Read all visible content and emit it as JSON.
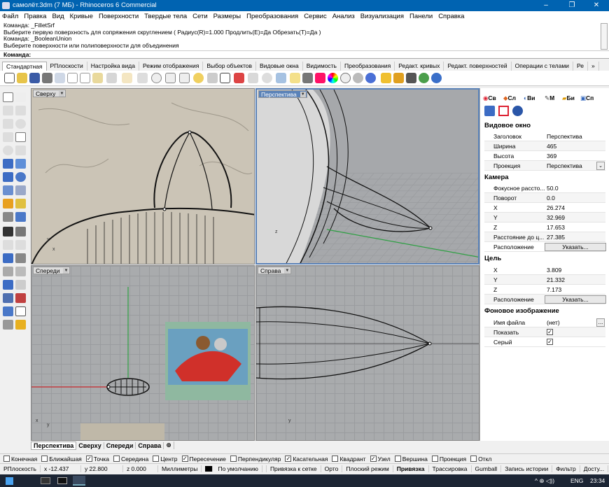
{
  "window": {
    "title": "самолёт.3dm (7 МБ) - Rhinoceros 6 Commercial",
    "minimize": "–",
    "maximize": "❐",
    "close": "✕"
  },
  "menu": [
    "Файл",
    "Правка",
    "Вид",
    "Кривые",
    "Поверхности",
    "Твердые тела",
    "Сети",
    "Размеры",
    "Преобразования",
    "Сервис",
    "Анализ",
    "Визуализация",
    "Панели",
    "Справка"
  ],
  "command_history": [
    "Команда: _FilletSrf",
    "Выберите первую поверхность для сопряжения скруглением ( Радиус(R)=1.000  Продлить(E)=Да  Обрезать(T)=Да )",
    "Команда: _BooleanUnion",
    "Выберите поверхности или полиповерхности для объединения"
  ],
  "command_prompt": "Команда:",
  "toolbar_tabs": [
    "Стандартная",
    "РПлоскости",
    "Настройка вида",
    "Режим отображения",
    "Выбор объектов",
    "Видовые окна",
    "Видимость",
    "Преобразования",
    "Редакт. кривых",
    "Редакт. поверхностей",
    "Операции с телами",
    "Ре"
  ],
  "toolbar_tabs_more": "»",
  "viewports": {
    "top": "Сверху",
    "perspective": "Перспектива",
    "front": "Спереди",
    "right": "Справа",
    "axis_x": "x",
    "axis_y": "y",
    "axis_z": "z"
  },
  "viewport_tabs": [
    "Перспектива",
    "Сверху",
    "Спереди",
    "Справа"
  ],
  "viewport_tab_add": "⊕",
  "panel": {
    "tabs": [
      "Св",
      "Сл",
      "Ви",
      "М",
      "Би",
      "Сп"
    ],
    "viewport_section": "Видовое окно",
    "title_label": "Заголовок",
    "title_value": "Перспектива",
    "width_label": "Ширина",
    "width_value": "465",
    "height_label": "Высота",
    "height_value": "369",
    "projection_label": "Проекция",
    "projection_value": "Перспектива",
    "camera_section": "Камера",
    "focal_label": "Фокусное рассто...",
    "focal_value": "50.0",
    "rotation_label": "Поворот",
    "rotation_value": "0.0",
    "cx_label": "X",
    "cx_value": "26.274",
    "cy_label": "Y",
    "cy_value": "32.969",
    "cz_label": "Z",
    "cz_value": "17.653",
    "dist_label": "Расстояние до ц...",
    "dist_value": "27.385",
    "loc_label": "Расположение",
    "loc_button": "Указать...",
    "target_section": "Цель",
    "tx_label": "X",
    "tx_value": "3.809",
    "ty_label": "Y",
    "ty_value": "21.332",
    "tz_label": "Z",
    "tz_value": "7.173",
    "tloc_label": "Расположение",
    "tloc_button": "Указать...",
    "bg_section": "Фоновое изображение",
    "file_label": "Имя файла",
    "file_value": "(нет)",
    "file_button": "...",
    "show_label": "Показать",
    "gray_label": "Серый"
  },
  "osnaps": [
    {
      "label": "Конечная",
      "checked": false
    },
    {
      "label": "Ближайшая",
      "checked": false
    },
    {
      "label": "Точка",
      "checked": true
    },
    {
      "label": "Середина",
      "checked": false
    },
    {
      "label": "Центр",
      "checked": false
    },
    {
      "label": "Пересечение",
      "checked": true
    },
    {
      "label": "Перпендикуляр",
      "checked": false
    },
    {
      "label": "Касательная",
      "checked": true
    },
    {
      "label": "Квадрант",
      "checked": false
    },
    {
      "label": "Узел",
      "checked": true
    },
    {
      "label": "Вершина",
      "checked": false
    },
    {
      "label": "Проекция",
      "checked": false
    },
    {
      "label": "Откл",
      "checked": false
    }
  ],
  "status": {
    "cplane": "РПлоскость",
    "x": "x -12.437",
    "y": "y 22.800",
    "z": "z 0.000",
    "units": "Миллиметры",
    "layer": "По умолчанию",
    "grid_snap": "Привязка к сетке",
    "ortho": "Орто",
    "planar": "Плоский режим",
    "osnap": "Привязка",
    "smarttrack": "Трассировка",
    "gumball": "Gumball",
    "history": "Запись истории",
    "filter": "Фильтр",
    "access": "Досту..."
  },
  "taskbar": {
    "lang": "ENG",
    "time": "23:34",
    "tray": "^ ⊕ ◁))"
  },
  "colors": {
    "titlebar": "#0063b1",
    "active_viewport": "#5a82b8",
    "x_axis": "#c8282d",
    "y_axis": "#2ea043"
  }
}
